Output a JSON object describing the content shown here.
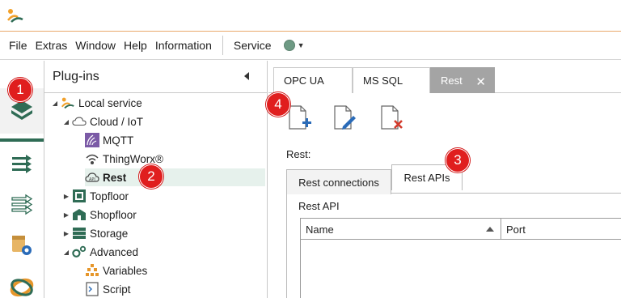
{
  "menu": {
    "items": [
      "File",
      "Extras",
      "Window",
      "Help",
      "Information"
    ],
    "service_label": "Service",
    "status_color": "#6e9a84"
  },
  "rail": {
    "icons": [
      "plugins-icon",
      "forward-arrows-icon",
      "outline-arrows-icon",
      "config-gear-icon",
      "ring-logo-icon"
    ]
  },
  "plugins": {
    "title": "Plug-ins",
    "tree": [
      {
        "label": "Local service",
        "icon": "local-service-icon",
        "expanded": true
      },
      {
        "label": "Cloud / IoT",
        "icon": "cloud-icon",
        "expanded": true
      },
      {
        "label": "MQTT",
        "icon": "mqtt-icon"
      },
      {
        "label": "ThingWorx®",
        "icon": "thingworx-icon"
      },
      {
        "label": "Rest",
        "icon": "rest-icon",
        "selected": true
      },
      {
        "label": "Topfloor",
        "icon": "topfloor-icon",
        "expanded": false
      },
      {
        "label": "Shopfloor",
        "icon": "shopfloor-icon",
        "expanded": false
      },
      {
        "label": "Storage",
        "icon": "storage-icon",
        "expanded": false
      },
      {
        "label": "Advanced",
        "icon": "advanced-icon",
        "expanded": true
      },
      {
        "label": "Variables",
        "icon": "variables-icon"
      },
      {
        "label": "Script",
        "icon": "script-icon"
      }
    ]
  },
  "doc_tabs": [
    {
      "label": "OPC UA"
    },
    {
      "label": "MS SQL"
    },
    {
      "label": "Rest",
      "active": true,
      "close": "✕"
    }
  ],
  "toolbar": {
    "buttons": [
      "new-document-icon",
      "edit-document-icon",
      "delete-document-icon"
    ]
  },
  "rest": {
    "label": "Rest:",
    "tabs": [
      {
        "label": "Rest connections"
      },
      {
        "label": "Rest APIs",
        "active": true
      }
    ],
    "section_title": "Rest API",
    "columns": [
      "Name",
      "Port"
    ]
  },
  "badges": [
    "1",
    "2",
    "3",
    "4"
  ],
  "colors": {
    "accent_green": "#2f6c55",
    "badge_red": "#e01e1e",
    "active_tab": "#a4a4a4",
    "menubar_border": "#e9a96b"
  }
}
